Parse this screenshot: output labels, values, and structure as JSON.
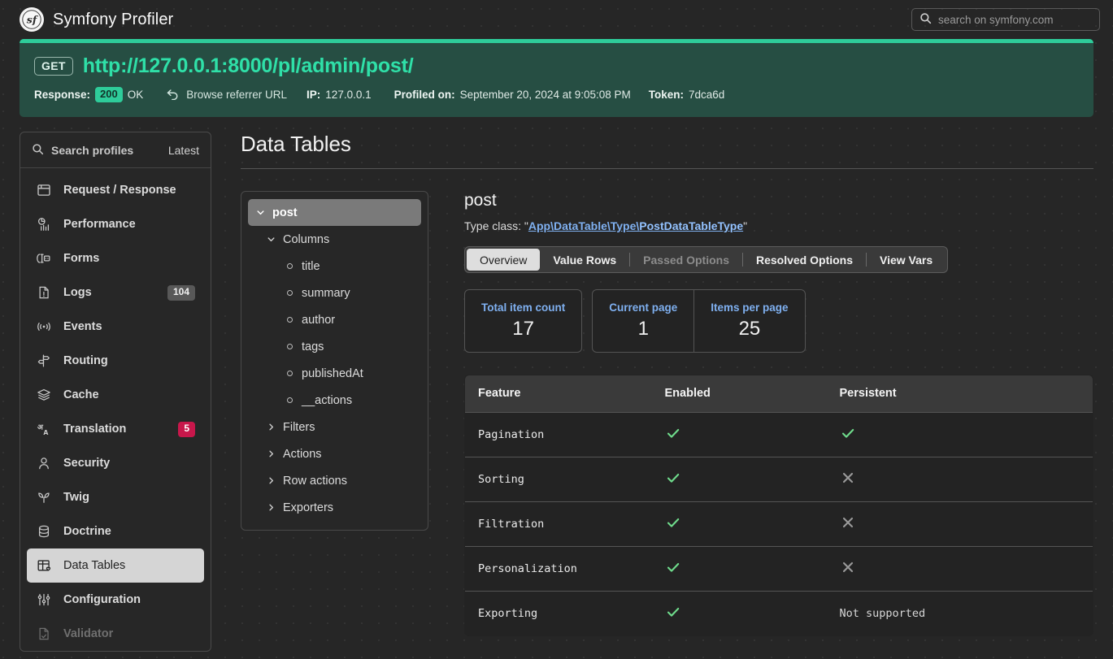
{
  "topbar": {
    "logo_icon": "symfony-logo-icon",
    "title": "Symfony Profiler",
    "search": {
      "icon": "search-icon",
      "placeholder": "search on symfony.com",
      "value": ""
    }
  },
  "request_banner": {
    "method": "GET",
    "url": "http://127.0.0.1:8000/pl/admin/post/",
    "response_label": "Response:",
    "status_code": "200",
    "status_text": "OK",
    "referrer_icon": "back-arrow-icon",
    "referrer_label": "Browse referrer URL",
    "ip_label": "IP:",
    "ip_value": "127.0.0.1",
    "profiled_label": "Profiled on:",
    "profiled_value": "September 20, 2024 at 9:05:08 PM",
    "token_label": "Token:",
    "token_value": "7dca6d",
    "accent_color": "#2ecc9a",
    "background_color": "#264e43"
  },
  "sidebar": {
    "search": {
      "icon": "search-icon",
      "label": "Search profiles",
      "latest_label": "Latest"
    },
    "items": [
      {
        "label": "Request / Response",
        "icon": "browser-window-icon",
        "badge": null,
        "state": "normal"
      },
      {
        "label": "Performance",
        "icon": "performance-chart-icon",
        "badge": null,
        "state": "normal"
      },
      {
        "label": "Forms",
        "icon": "form-field-icon",
        "badge": null,
        "state": "normal"
      },
      {
        "label": "Logs",
        "icon": "document-alert-icon",
        "badge": "104",
        "badge_color": "#585858",
        "state": "normal"
      },
      {
        "label": "Events",
        "icon": "broadcast-icon",
        "badge": null,
        "state": "normal"
      },
      {
        "label": "Routing",
        "icon": "signpost-icon",
        "badge": null,
        "state": "normal"
      },
      {
        "label": "Cache",
        "icon": "layers-icon",
        "badge": null,
        "state": "normal"
      },
      {
        "label": "Translation",
        "icon": "translate-icon",
        "badge": "5",
        "badge_color": "#c8174b",
        "state": "normal"
      },
      {
        "label": "Security",
        "icon": "user-icon",
        "badge": null,
        "state": "normal"
      },
      {
        "label": "Twig",
        "icon": "leaf-icon",
        "badge": null,
        "state": "normal"
      },
      {
        "label": "Doctrine",
        "icon": "database-icon",
        "badge": null,
        "state": "normal"
      },
      {
        "label": "Data Tables",
        "icon": "table-heart-icon",
        "badge": null,
        "state": "active"
      },
      {
        "label": "Configuration",
        "icon": "sliders-icon",
        "badge": null,
        "state": "normal"
      },
      {
        "label": "Validator",
        "icon": "document-check-icon",
        "badge": null,
        "state": "disabled"
      }
    ]
  },
  "main": {
    "page_title": "Data Tables",
    "tree": {
      "root": {
        "label": "post",
        "chevron": "chevron-down-icon",
        "expanded": true
      },
      "groups": [
        {
          "label": "Columns",
          "chevron": "chevron-down-icon",
          "expanded": true,
          "children": [
            {
              "label": "title"
            },
            {
              "label": "summary"
            },
            {
              "label": "author"
            },
            {
              "label": "tags"
            },
            {
              "label": "publishedAt"
            },
            {
              "label": "__actions"
            }
          ]
        },
        {
          "label": "Filters",
          "chevron": "chevron-right-icon",
          "expanded": false,
          "children": []
        },
        {
          "label": "Actions",
          "chevron": "chevron-right-icon",
          "expanded": false,
          "children": []
        },
        {
          "label": "Row actions",
          "chevron": "chevron-right-icon",
          "expanded": false,
          "children": []
        },
        {
          "label": "Exporters",
          "chevron": "chevron-right-icon",
          "expanded": false,
          "children": []
        }
      ]
    },
    "detail": {
      "title": "post",
      "type_class_prefix": "Type class: \"",
      "type_class_head": "App\\DataTable\\Type\\",
      "type_class_tail": "PostDataTableType",
      "type_class_suffix": "\"",
      "link_color": "#7fb0f0",
      "tabs": [
        {
          "label": "Overview",
          "state": "active"
        },
        {
          "label": "Value Rows",
          "state": "normal"
        },
        {
          "label": "Passed Options",
          "state": "disabled"
        },
        {
          "label": "Resolved Options",
          "state": "normal"
        },
        {
          "label": "View Vars",
          "state": "normal"
        }
      ],
      "stats": [
        [
          {
            "label": "Total item count",
            "value": "17"
          }
        ],
        [
          {
            "label": "Current page",
            "value": "1"
          },
          {
            "label": "Items per page",
            "value": "25"
          }
        ]
      ],
      "feature_table": {
        "headers": [
          "Feature",
          "Enabled",
          "Persistent"
        ],
        "rows": [
          {
            "feature": "Pagination",
            "enabled": "check",
            "persistent": "check"
          },
          {
            "feature": "Sorting",
            "enabled": "check",
            "persistent": "cross"
          },
          {
            "feature": "Filtration",
            "enabled": "check",
            "persistent": "cross"
          },
          {
            "feature": "Personalization",
            "enabled": "check",
            "persistent": "cross"
          },
          {
            "feature": "Exporting",
            "enabled": "check",
            "persistent": "Not supported"
          }
        ],
        "check_color": "#6fdc8c",
        "cross_color": "#9a9a9a"
      }
    }
  }
}
